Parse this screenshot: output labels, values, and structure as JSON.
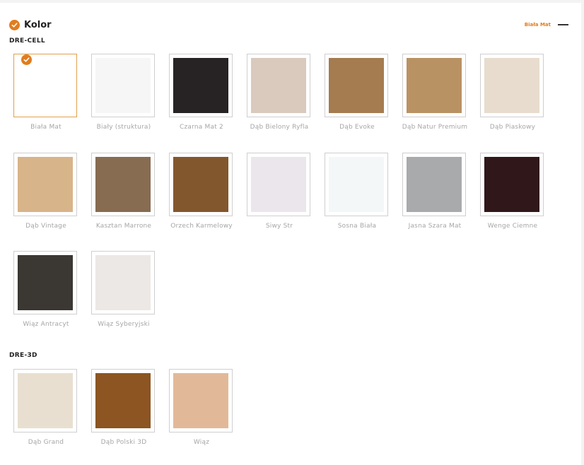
{
  "header": {
    "title": "Kolor",
    "selected_value": "Biała Mat"
  },
  "colors": {
    "accent": "#e07d1e"
  },
  "icons": {
    "header": "check-icon",
    "collapse": "minus-icon",
    "selected": "check-icon"
  },
  "sections": [
    {
      "label": "DRE-CELL",
      "swatches": [
        {
          "name": "Biała Mat",
          "color": "#ffffff",
          "selected": true
        },
        {
          "name": "Biały (struktura)",
          "color": "#f6f6f6",
          "selected": false
        },
        {
          "name": "Czarna Mat 2",
          "color": "#272224",
          "selected": false
        },
        {
          "name": "Dąb Bielony Ryfla",
          "color": "#d9cabd",
          "selected": false
        },
        {
          "name": "Dąb Evoke",
          "color": "#a57b50",
          "selected": false
        },
        {
          "name": "Dąb Natur Premium",
          "color": "#b99264",
          "selected": false
        },
        {
          "name": "Dąb Piaskowy",
          "color": "#e7dccd",
          "selected": false
        },
        {
          "name": "Dąb Vintage",
          "color": "#d8b48a",
          "selected": false
        },
        {
          "name": "Kasztan Marrone",
          "color": "#876c52",
          "selected": false
        },
        {
          "name": "Orzech Karmelowy",
          "color": "#83572d",
          "selected": false
        },
        {
          "name": "Siwy Str",
          "color": "#ebe6ec",
          "selected": false
        },
        {
          "name": "Sosna Biała",
          "color": "#f4f7f7",
          "selected": false
        },
        {
          "name": "Jasna Szara Mat",
          "color": "#a8aaac",
          "selected": false
        },
        {
          "name": "Wenge Ciemne",
          "color": "#30181a",
          "selected": false
        },
        {
          "name": "Wiąz Antracyt",
          "color": "#3b3733",
          "selected": false
        },
        {
          "name": "Wiąz Syberyjski",
          "color": "#ece8e5",
          "selected": false
        }
      ]
    },
    {
      "label": "DRE-3D",
      "swatches": [
        {
          "name": "Dąb Grand",
          "color": "#e8dfd0",
          "selected": false
        },
        {
          "name": "Dąb Polski 3D",
          "color": "#8c5522",
          "selected": false
        },
        {
          "name": "Wiąz",
          "color": "#e2b998",
          "selected": false
        }
      ]
    }
  ]
}
